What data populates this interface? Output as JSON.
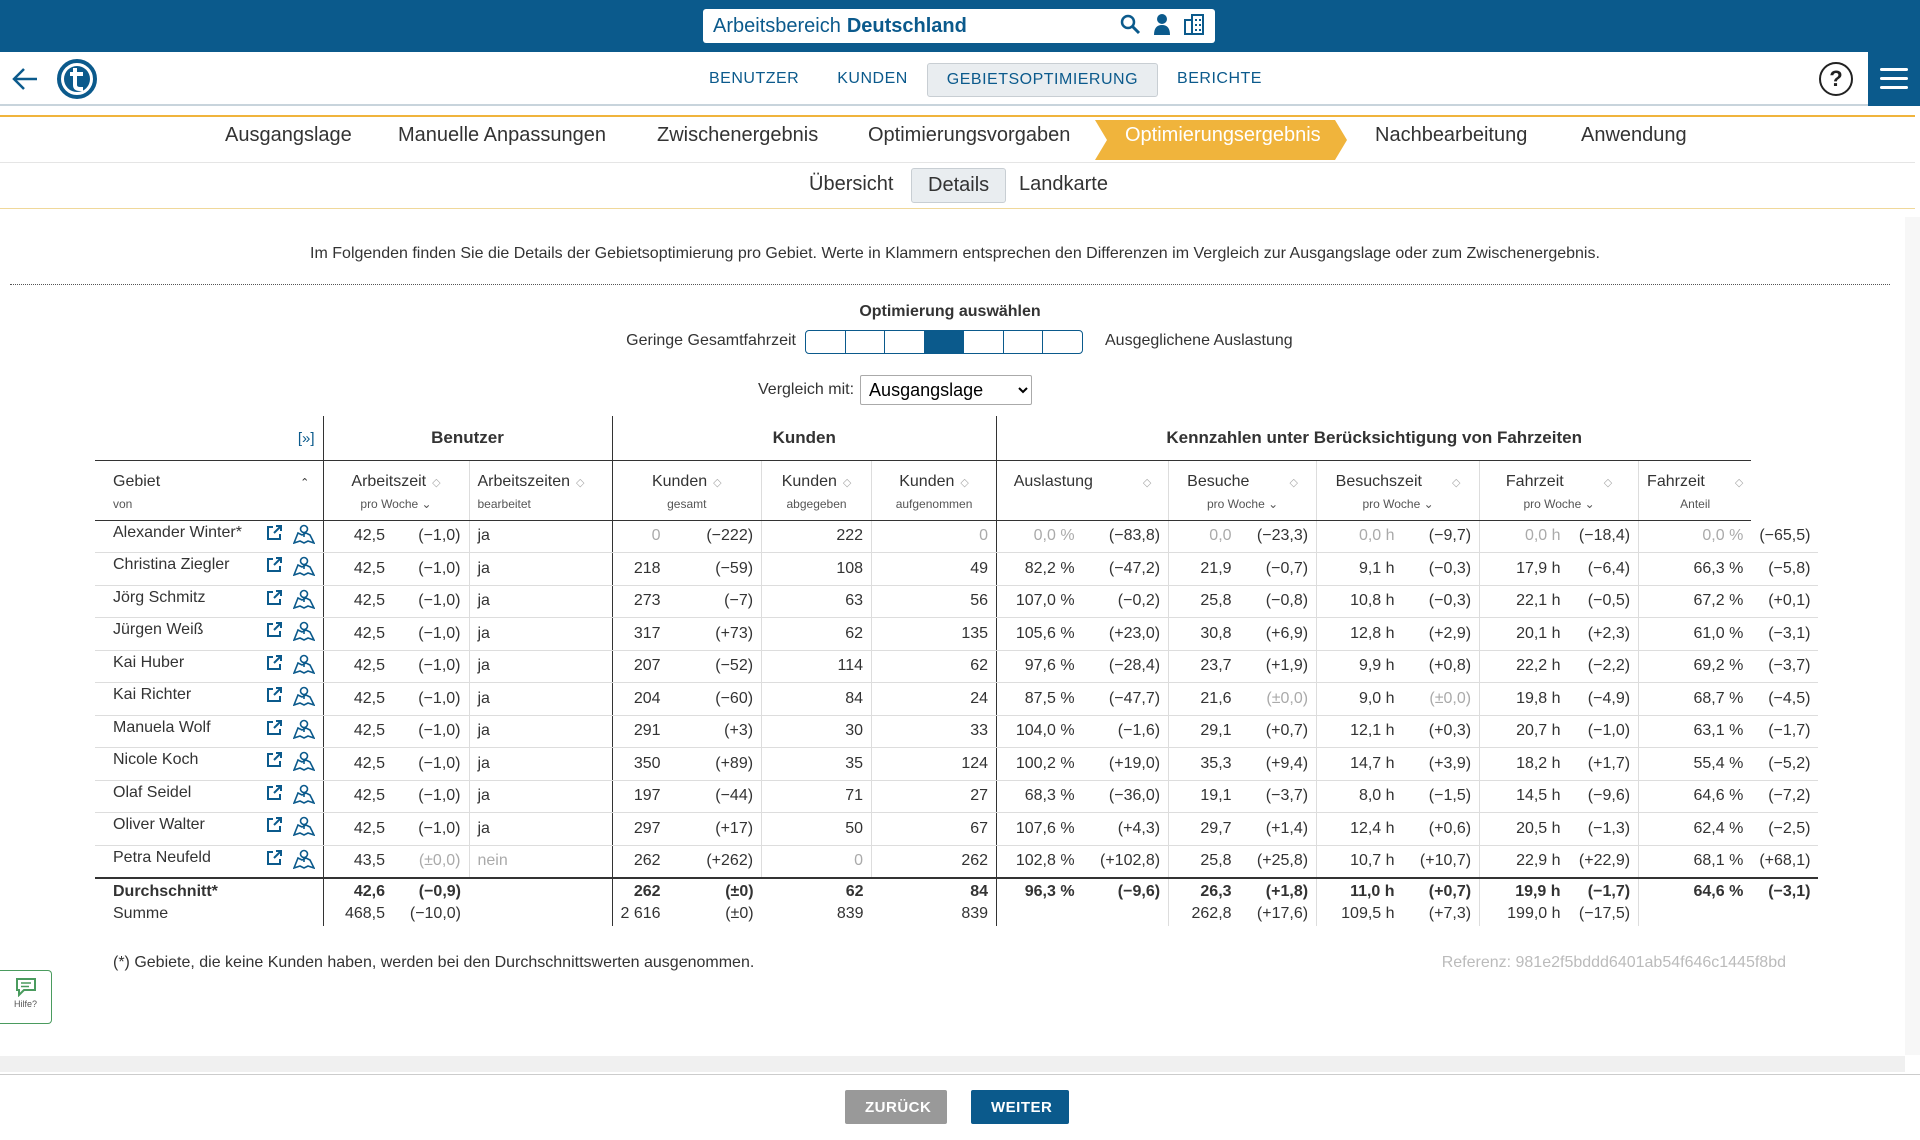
{
  "workspace": {
    "label": "Arbeitsbereich",
    "name": "Deutschland"
  },
  "nav": [
    {
      "label": "BENUTZER",
      "active": false
    },
    {
      "label": "KUNDEN",
      "active": false
    },
    {
      "label": "GEBIETSOPTIMIERUNG",
      "active": true
    },
    {
      "label": "BERICHTE",
      "active": false
    }
  ],
  "steps": [
    "Ausgangslage",
    "Manuelle Anpassungen",
    "Zwischenergebnis",
    "Optimierungsvorgaben",
    "Optimierungsergebnis",
    "Nachbearbeitung",
    "Anwendung"
  ],
  "active_step": "Optimierungsergebnis",
  "subtabs": [
    {
      "label": "Übersicht",
      "active": false
    },
    {
      "label": "Details",
      "active": true
    },
    {
      "label": "Landkarte",
      "active": false
    }
  ],
  "intro": "Im Folgenden finden Sie die Details der Gebietsoptimierung pro Gebiet. Werte in Klammern entsprechen den Differenzen im Vergleich zur Ausgangslage oder zum Zwischenergebnis.",
  "optimization": {
    "title": "Optimierung auswählen",
    "left_label": "Geringe Gesamtfahrzeit",
    "right_label": "Ausgeglichene Auslastung",
    "segments": 7,
    "selected": 4
  },
  "compare": {
    "label": "Vergleich mit:",
    "value": "Ausgangslage"
  },
  "table": {
    "expand": "[»]",
    "groups": {
      "benutzer": "Benutzer",
      "kunden": "Kunden",
      "kennzahlen": "Kennzahlen unter Berücksichtigung von Fahrzeiten"
    },
    "headers": {
      "gebiet": {
        "h1": "Gebiet",
        "h2": "von"
      },
      "arbeitszeit": {
        "h1": "Arbeitszeit",
        "h2": "pro Woche"
      },
      "bearbeitet": {
        "h1": "Arbeitszeiten",
        "h2": "bearbeitet"
      },
      "kunden_gesamt": {
        "h1": "Kunden",
        "h2": "gesamt"
      },
      "kunden_abgegeben": {
        "h1": "Kunden",
        "h2": "abgegeben"
      },
      "kunden_aufgenommen": {
        "h1": "Kunden",
        "h2": "aufgenommen"
      },
      "auslastung": {
        "h1": "Auslastung",
        "h2": ""
      },
      "besuche": {
        "h1": "Besuche",
        "h2": "pro Woche"
      },
      "besuchszeit": {
        "h1": "Besuchszeit",
        "h2": "pro Woche"
      },
      "fahrzeit": {
        "h1": "Fahrzeit",
        "h2": "pro Woche"
      },
      "fahrzeit_anteil": {
        "h1": "Fahrzeit",
        "h2": "Anteil"
      }
    },
    "rows": [
      {
        "name": "Alexander Winter*",
        "az": "42,5",
        "az_d": "(−1,0)",
        "bearb": "ja",
        "kg": "0",
        "kg_d": "(−222)",
        "ab": "222",
        "auf": "0",
        "aus": "0,0 %",
        "aus_d": "(−83,8)",
        "bes": "0,0",
        "bes_d": "(−23,3)",
        "bz": "0,0 h",
        "bz_d": "(−9,7)",
        "fz": "0,0 h",
        "fz_d": "(−18,4)",
        "fa": "0,0 %",
        "fa_d": "(−65,5)",
        "zero": true
      },
      {
        "name": "Christina Ziegler",
        "az": "42,5",
        "az_d": "(−1,0)",
        "bearb": "ja",
        "kg": "218",
        "kg_d": "(−59)",
        "ab": "108",
        "auf": "49",
        "aus": "82,2 %",
        "aus_d": "(−47,2)",
        "bes": "21,9",
        "bes_d": "(−0,7)",
        "bz": "9,1 h",
        "bz_d": "(−0,3)",
        "fz": "17,9 h",
        "fz_d": "(−6,4)",
        "fa": "66,3 %",
        "fa_d": "(−5,8)"
      },
      {
        "name": "Jörg Schmitz",
        "az": "42,5",
        "az_d": "(−1,0)",
        "bearb": "ja",
        "kg": "273",
        "kg_d": "(−7)",
        "ab": "63",
        "auf": "56",
        "aus": "107,0 %",
        "aus_d": "(−0,2)",
        "bes": "25,8",
        "bes_d": "(−0,8)",
        "bz": "10,8 h",
        "bz_d": "(−0,3)",
        "fz": "22,1 h",
        "fz_d": "(−0,5)",
        "fa": "67,2 %",
        "fa_d": "(+0,1)"
      },
      {
        "name": "Jürgen Weiß",
        "az": "42,5",
        "az_d": "(−1,0)",
        "bearb": "ja",
        "kg": "317",
        "kg_d": "(+73)",
        "ab": "62",
        "auf": "135",
        "aus": "105,6 %",
        "aus_d": "(+23,0)",
        "bes": "30,8",
        "bes_d": "(+6,9)",
        "bz": "12,8 h",
        "bz_d": "(+2,9)",
        "fz": "20,1 h",
        "fz_d": "(+2,3)",
        "fa": "61,0 %",
        "fa_d": "(−3,1)"
      },
      {
        "name": "Kai Huber",
        "az": "42,5",
        "az_d": "(−1,0)",
        "bearb": "ja",
        "kg": "207",
        "kg_d": "(−52)",
        "ab": "114",
        "auf": "62",
        "aus": "97,6 %",
        "aus_d": "(−28,4)",
        "bes": "23,7",
        "bes_d": "(+1,9)",
        "bz": "9,9 h",
        "bz_d": "(+0,8)",
        "fz": "22,2 h",
        "fz_d": "(−2,2)",
        "fa": "69,2 %",
        "fa_d": "(−3,7)"
      },
      {
        "name": "Kai Richter",
        "az": "42,5",
        "az_d": "(−1,0)",
        "bearb": "ja",
        "kg": "204",
        "kg_d": "(−60)",
        "ab": "84",
        "auf": "24",
        "aus": "87,5 %",
        "aus_d": "(−47,7)",
        "bes": "21,6",
        "bes_d": "(±0,0)",
        "bz": "9,0 h",
        "bz_d": "(±0,0)",
        "fz": "19,8 h",
        "fz_d": "(−4,9)",
        "fa": "68,7 %",
        "fa_d": "(−4,5)"
      },
      {
        "name": "Manuela Wolf",
        "az": "42,5",
        "az_d": "(−1,0)",
        "bearb": "ja",
        "kg": "291",
        "kg_d": "(+3)",
        "ab": "30",
        "auf": "33",
        "aus": "104,0 %",
        "aus_d": "(−1,6)",
        "bes": "29,1",
        "bes_d": "(+0,7)",
        "bz": "12,1 h",
        "bz_d": "(+0,3)",
        "fz": "20,7 h",
        "fz_d": "(−1,0)",
        "fa": "63,1 %",
        "fa_d": "(−1,7)"
      },
      {
        "name": "Nicole Koch",
        "az": "42,5",
        "az_d": "(−1,0)",
        "bearb": "ja",
        "kg": "350",
        "kg_d": "(+89)",
        "ab": "35",
        "auf": "124",
        "aus": "100,2 %",
        "aus_d": "(+19,0)",
        "bes": "35,3",
        "bes_d": "(+9,4)",
        "bz": "14,7 h",
        "bz_d": "(+3,9)",
        "fz": "18,2 h",
        "fz_d": "(+1,7)",
        "fa": "55,4 %",
        "fa_d": "(−5,2)"
      },
      {
        "name": "Olaf Seidel",
        "az": "42,5",
        "az_d": "(−1,0)",
        "bearb": "ja",
        "kg": "197",
        "kg_d": "(−44)",
        "ab": "71",
        "auf": "27",
        "aus": "68,3 %",
        "aus_d": "(−36,0)",
        "bes": "19,1",
        "bes_d": "(−3,7)",
        "bz": "8,0 h",
        "bz_d": "(−1,5)",
        "fz": "14,5 h",
        "fz_d": "(−9,6)",
        "fa": "64,6 %",
        "fa_d": "(−7,2)"
      },
      {
        "name": "Oliver Walter",
        "az": "42,5",
        "az_d": "(−1,0)",
        "bearb": "ja",
        "kg": "297",
        "kg_d": "(+17)",
        "ab": "50",
        "auf": "67",
        "aus": "107,6 %",
        "aus_d": "(+4,3)",
        "bes": "29,7",
        "bes_d": "(+1,4)",
        "bz": "12,4 h",
        "bz_d": "(+0,6)",
        "fz": "20,5 h",
        "fz_d": "(−1,3)",
        "fa": "62,4 %",
        "fa_d": "(−2,5)"
      },
      {
        "name": "Petra Neufeld",
        "az": "43,5",
        "az_d": "(±0,0)",
        "bearb": "nein",
        "kg": "262",
        "kg_d": "(+262)",
        "ab": "0",
        "auf": "262",
        "aus": "102,8 %",
        "aus_d": "(+102,8)",
        "bes": "25,8",
        "bes_d": "(+25,8)",
        "bz": "10,7 h",
        "bz_d": "(+10,7)",
        "fz": "22,9 h",
        "fz_d": "(+22,9)",
        "fa": "68,1 %",
        "fa_d": "(+68,1)"
      }
    ],
    "avg": {
      "label": "Durchschnitt*",
      "az": "42,6",
      "az_d": "(−0,9)",
      "kg": "262",
      "kg_d": "(±0)",
      "ab": "62",
      "auf": "84",
      "aus": "96,3 %",
      "aus_d": "(−9,6)",
      "bes": "26,3",
      "bes_d": "(+1,8)",
      "bz": "11,0 h",
      "bz_d": "(+0,7)",
      "fz": "19,9 h",
      "fz_d": "(−1,7)",
      "fa": "64,6 %",
      "fa_d": "(−3,1)"
    },
    "sum": {
      "label": "Summe",
      "az": "468,5",
      "az_d": "(−10,0)",
      "kg": "2 616",
      "kg_d": "(±0)",
      "ab": "839",
      "auf": "839",
      "bes": "262,8",
      "bes_d": "(+17,6)",
      "bz": "109,5 h",
      "bz_d": "(+7,3)",
      "fz": "199,0 h",
      "fz_d": "(−17,5)"
    }
  },
  "note": "(*) Gebiete, die keine Kunden haben, werden bei den Durchschnittswerten ausgenommen.",
  "reference": "Referenz: 981e2f5bddd6401ab54f646c1445f8bd",
  "help_label": "Hilfe?",
  "buttons": {
    "back": "ZURÜCK",
    "next": "WEITER"
  },
  "colors": {
    "primary": "#0b5a8c",
    "accent": "#f0b43c",
    "link_icon": "#0b5a8c"
  }
}
